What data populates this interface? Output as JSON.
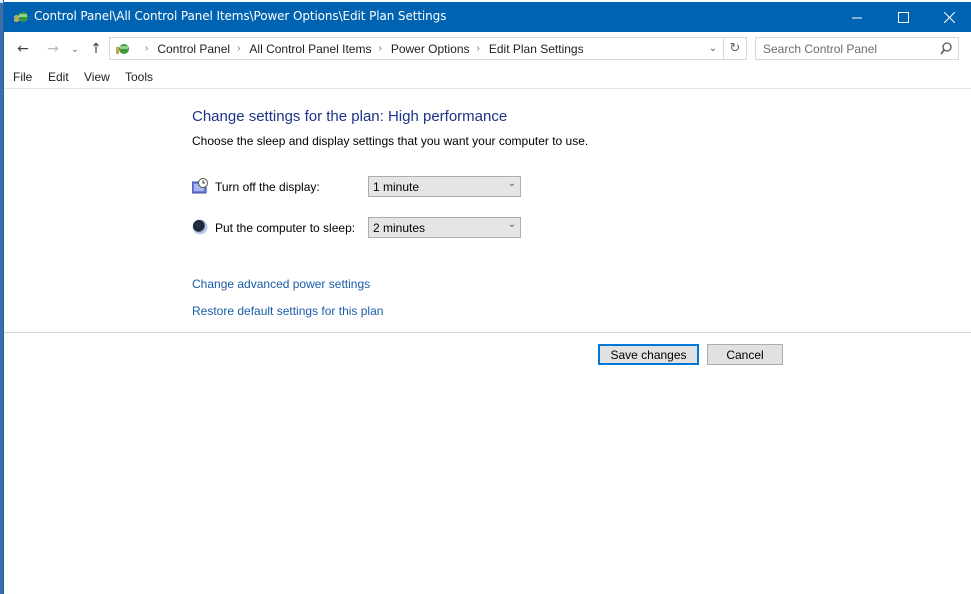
{
  "window": {
    "title": "Control Panel\\All Control Panel Items\\Power Options\\Edit Plan Settings",
    "app_icon": "control-panel-icon",
    "controls": {
      "minimize": "minimize-icon",
      "maximize": "maximize-icon",
      "close": "close-icon"
    }
  },
  "nav": {
    "back": "←",
    "forward": "→",
    "recent": "⌄",
    "up": "↑",
    "breadcrumb": [
      "Control Panel",
      "All Control Panel Items",
      "Power Options",
      "Edit Plan Settings"
    ],
    "breadcrumb_separator": "›",
    "refresh": "↻",
    "dropdown": "⌄"
  },
  "search": {
    "placeholder": "Search Control Panel",
    "value": ""
  },
  "menu": [
    "File",
    "Edit",
    "View",
    "Tools"
  ],
  "content": {
    "heading": "Change settings for the plan: High performance",
    "subtitle": "Choose the sleep and display settings that you want your computer to use.",
    "settings": [
      {
        "label": "Turn off the display:",
        "value": "1 minute",
        "icon": "display-timer-icon"
      },
      {
        "label": "Put the computer to sleep:",
        "value": "2 minutes",
        "icon": "sleep-moon-icon"
      }
    ],
    "links": [
      "Change advanced power settings",
      "Restore default settings for this plan"
    ],
    "buttons": {
      "save": "Save changes",
      "cancel": "Cancel"
    }
  },
  "colors": {
    "titlebar": "#0063b1",
    "heading": "#1e3287",
    "link": "#1a5ca8",
    "focus": "#0078d7"
  }
}
